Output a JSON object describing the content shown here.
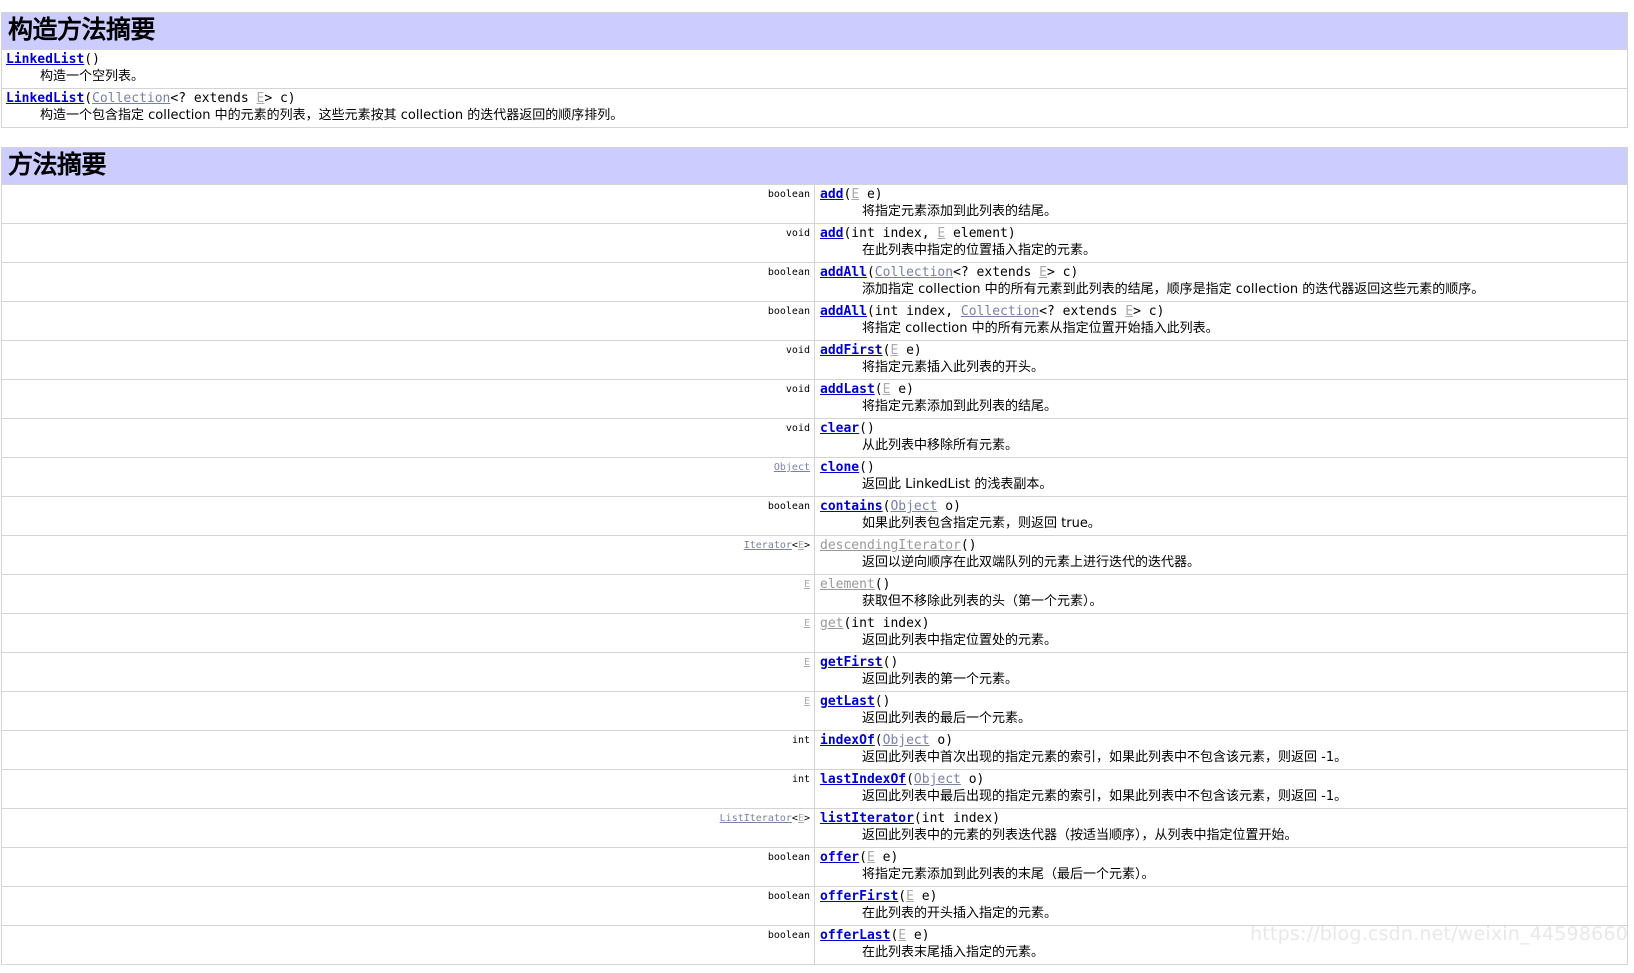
{
  "watermark": "https://blog.csdn.net/weixin_44598660",
  "constructor_section": {
    "title": "构造方法摘要",
    "rows": [
      {
        "sig_parts": [
          {
            "text": "LinkedList",
            "style": "lnk"
          },
          {
            "text": "()",
            "style": "tok"
          }
        ],
        "desc": "构造一个空列表。"
      },
      {
        "sig_parts": [
          {
            "text": "LinkedList",
            "style": "lnk"
          },
          {
            "text": "(",
            "style": "tok"
          },
          {
            "text": "Collection",
            "style": "lnk-plain"
          },
          {
            "text": "<? extends ",
            "style": "tok"
          },
          {
            "text": "E",
            "style": "tparam"
          },
          {
            "text": "> c)",
            "style": "tok"
          }
        ],
        "desc": "构造一个包含指定 collection 中的元素的列表，这些元素按其 collection 的迭代器返回的顺序排列。"
      }
    ]
  },
  "method_section": {
    "title": "方法摘要",
    "rows": [
      {
        "type_parts": [
          {
            "text": "boolean",
            "style": "tok"
          }
        ],
        "sig_parts": [
          {
            "text": "add",
            "style": "lnk"
          },
          {
            "text": "(",
            "style": "tok"
          },
          {
            "text": "E",
            "style": "tparam"
          },
          {
            "text": " e)",
            "style": "tok"
          }
        ],
        "desc": "将指定元素添加到此列表的结尾。"
      },
      {
        "type_parts": [
          {
            "text": "void",
            "style": "tok"
          }
        ],
        "sig_parts": [
          {
            "text": "add",
            "style": "lnk"
          },
          {
            "text": "(int index, ",
            "style": "tok"
          },
          {
            "text": "E",
            "style": "tparam"
          },
          {
            "text": " element)",
            "style": "tok"
          }
        ],
        "desc": "在此列表中指定的位置插入指定的元素。"
      },
      {
        "type_parts": [
          {
            "text": "boolean",
            "style": "tok"
          }
        ],
        "sig_parts": [
          {
            "text": "addAll",
            "style": "lnk"
          },
          {
            "text": "(",
            "style": "tok"
          },
          {
            "text": "Collection",
            "style": "lnk-plain"
          },
          {
            "text": "<? extends ",
            "style": "tok"
          },
          {
            "text": "E",
            "style": "tparam"
          },
          {
            "text": "> c)",
            "style": "tok"
          }
        ],
        "desc": "添加指定 collection 中的所有元素到此列表的结尾，顺序是指定 collection 的迭代器返回这些元素的顺序。"
      },
      {
        "type_parts": [
          {
            "text": "boolean",
            "style": "tok"
          }
        ],
        "sig_parts": [
          {
            "text": "addAll",
            "style": "lnk"
          },
          {
            "text": "(int index, ",
            "style": "tok"
          },
          {
            "text": "Collection",
            "style": "lnk-plain"
          },
          {
            "text": "<? extends ",
            "style": "tok"
          },
          {
            "text": "E",
            "style": "tparam"
          },
          {
            "text": "> c)",
            "style": "tok"
          }
        ],
        "desc": "将指定 collection 中的所有元素从指定位置开始插入此列表。"
      },
      {
        "type_parts": [
          {
            "text": "void",
            "style": "tok"
          }
        ],
        "sig_parts": [
          {
            "text": "addFirst",
            "style": "lnk"
          },
          {
            "text": "(",
            "style": "tok"
          },
          {
            "text": "E",
            "style": "tparam"
          },
          {
            "text": " e)",
            "style": "tok"
          }
        ],
        "desc": "将指定元素插入此列表的开头。"
      },
      {
        "type_parts": [
          {
            "text": "void",
            "style": "tok"
          }
        ],
        "sig_parts": [
          {
            "text": "addLast",
            "style": "lnk"
          },
          {
            "text": "(",
            "style": "tok"
          },
          {
            "text": "E",
            "style": "tparam"
          },
          {
            "text": " e)",
            "style": "tok"
          }
        ],
        "desc": "将指定元素添加到此列表的结尾。"
      },
      {
        "type_parts": [
          {
            "text": "void",
            "style": "tok"
          }
        ],
        "sig_parts": [
          {
            "text": "clear",
            "style": "lnk"
          },
          {
            "text": "()",
            "style": "tok"
          }
        ],
        "desc": "从此列表中移除所有元素。"
      },
      {
        "type_parts": [
          {
            "text": "Object",
            "style": "lnk-plain"
          }
        ],
        "sig_parts": [
          {
            "text": "clone",
            "style": "lnk"
          },
          {
            "text": "()",
            "style": "tok"
          }
        ],
        "desc": "返回此 LinkedList 的浅表副本。"
      },
      {
        "type_parts": [
          {
            "text": "boolean",
            "style": "tok"
          }
        ],
        "sig_parts": [
          {
            "text": "contains",
            "style": "lnk"
          },
          {
            "text": "(",
            "style": "tok"
          },
          {
            "text": "Object",
            "style": "lnk-plain"
          },
          {
            "text": " o)",
            "style": "tok"
          }
        ],
        "desc": "如果此列表包含指定元素，则返回 true。"
      },
      {
        "type_parts": [
          {
            "text": "Iterator",
            "style": "lnk-plain"
          },
          {
            "text": "<",
            "style": "tok"
          },
          {
            "text": "E",
            "style": "tparam"
          },
          {
            "text": ">",
            "style": "tok"
          }
        ],
        "sig_parts": [
          {
            "text": "descendingIterator",
            "style": "lnk-v"
          },
          {
            "text": "()",
            "style": "tok"
          }
        ],
        "desc": "返回以逆向顺序在此双端队列的元素上进行迭代的迭代器。"
      },
      {
        "type_parts": [
          {
            "text": "E",
            "style": "tparam"
          }
        ],
        "sig_parts": [
          {
            "text": "element",
            "style": "lnk-v"
          },
          {
            "text": "()",
            "style": "tok"
          }
        ],
        "desc": "获取但不移除此列表的头（第一个元素）。"
      },
      {
        "type_parts": [
          {
            "text": "E",
            "style": "tparam"
          }
        ],
        "sig_parts": [
          {
            "text": "get",
            "style": "lnk-v"
          },
          {
            "text": "(int index)",
            "style": "tok"
          }
        ],
        "desc": "返回此列表中指定位置处的元素。"
      },
      {
        "type_parts": [
          {
            "text": "E",
            "style": "tparam"
          }
        ],
        "sig_parts": [
          {
            "text": "getFirst",
            "style": "lnk"
          },
          {
            "text": "()",
            "style": "tok"
          }
        ],
        "desc": "返回此列表的第一个元素。"
      },
      {
        "type_parts": [
          {
            "text": "E",
            "style": "tparam"
          }
        ],
        "sig_parts": [
          {
            "text": "getLast",
            "style": "lnk"
          },
          {
            "text": "()",
            "style": "tok"
          }
        ],
        "desc": "返回此列表的最后一个元素。"
      },
      {
        "type_parts": [
          {
            "text": "int",
            "style": "tok"
          }
        ],
        "sig_parts": [
          {
            "text": "indexOf",
            "style": "lnk"
          },
          {
            "text": "(",
            "style": "tok"
          },
          {
            "text": "Object",
            "style": "lnk-plain"
          },
          {
            "text": " o)",
            "style": "tok"
          }
        ],
        "desc": "返回此列表中首次出现的指定元素的索引，如果此列表中不包含该元素，则返回 -1。"
      },
      {
        "type_parts": [
          {
            "text": "int",
            "style": "tok"
          }
        ],
        "sig_parts": [
          {
            "text": "lastIndexOf",
            "style": "lnk"
          },
          {
            "text": "(",
            "style": "tok"
          },
          {
            "text": "Object",
            "style": "lnk-plain"
          },
          {
            "text": " o)",
            "style": "tok"
          }
        ],
        "desc": "返回此列表中最后出现的指定元素的索引，如果此列表中不包含该元素，则返回 -1。"
      },
      {
        "type_parts": [
          {
            "text": "ListIterator",
            "style": "lnk-plain"
          },
          {
            "text": "<",
            "style": "tok"
          },
          {
            "text": "E",
            "style": "tparam"
          },
          {
            "text": ">",
            "style": "tok"
          }
        ],
        "sig_parts": [
          {
            "text": "listIterator",
            "style": "lnk"
          },
          {
            "text": "(int index)",
            "style": "tok"
          }
        ],
        "desc": "返回此列表中的元素的列表迭代器（按适当顺序），从列表中指定位置开始。"
      },
      {
        "type_parts": [
          {
            "text": "boolean",
            "style": "tok"
          }
        ],
        "sig_parts": [
          {
            "text": "offer",
            "style": "lnk"
          },
          {
            "text": "(",
            "style": "tok"
          },
          {
            "text": "E",
            "style": "tparam"
          },
          {
            "text": " e)",
            "style": "tok"
          }
        ],
        "desc": "将指定元素添加到此列表的末尾（最后一个元素）。"
      },
      {
        "type_parts": [
          {
            "text": "boolean",
            "style": "tok"
          }
        ],
        "sig_parts": [
          {
            "text": "offerFirst",
            "style": "lnk"
          },
          {
            "text": "(",
            "style": "tok"
          },
          {
            "text": "E",
            "style": "tparam"
          },
          {
            "text": " e)",
            "style": "tok"
          }
        ],
        "desc": "在此列表的开头插入指定的元素。"
      },
      {
        "type_parts": [
          {
            "text": "boolean",
            "style": "tok"
          }
        ],
        "sig_parts": [
          {
            "text": "offerLast",
            "style": "lnk"
          },
          {
            "text": "(",
            "style": "tok"
          },
          {
            "text": "E",
            "style": "tparam"
          },
          {
            "text": " e)",
            "style": "tok"
          }
        ],
        "desc": "在此列表末尾插入指定的元素。"
      }
    ]
  }
}
